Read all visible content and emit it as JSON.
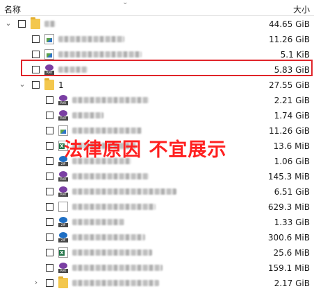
{
  "header": {
    "name_col": "名称",
    "size_col": "大小",
    "sort_glyph": "⌄"
  },
  "rows": [
    {
      "level": 0,
      "expand": "⌄",
      "icon": "folder",
      "name_blurred": true,
      "size": "44.65 GiB"
    },
    {
      "level": 1,
      "expand": "",
      "icon": "image-file",
      "name_blurred": true,
      "size": "11.26 GiB"
    },
    {
      "level": 1,
      "expand": "",
      "icon": "image-file",
      "name_blurred": true,
      "size": "5.1 KiB"
    },
    {
      "level": 1,
      "expand": "",
      "icon": "rar-archive",
      "name_blurred": true,
      "size": "5.83 GiB",
      "highlighted": true
    },
    {
      "level": 1,
      "expand": "⌄",
      "icon": "folder",
      "name": "1",
      "size": "27.55 GiB"
    },
    {
      "level": 2,
      "expand": "",
      "icon": "rar-archive",
      "name_blurred": true,
      "size": "2.21 GiB"
    },
    {
      "level": 2,
      "expand": "",
      "icon": "rar-archive",
      "name_blurred": true,
      "size": "1.74 GiB"
    },
    {
      "level": 2,
      "expand": "",
      "icon": "image-file",
      "name_blurred": true,
      "size": "11.26 GiB"
    },
    {
      "level": 2,
      "expand": "",
      "icon": "excel-file",
      "name_blurred": true,
      "size": "13.6 MiB"
    },
    {
      "level": 2,
      "expand": "",
      "icon": "zip-archive",
      "name_blurred": true,
      "size": "1.06 GiB"
    },
    {
      "level": 2,
      "expand": "",
      "icon": "rar-archive",
      "name_blurred": true,
      "size": "145.3 MiB"
    },
    {
      "level": 2,
      "expand": "",
      "icon": "rar-archive",
      "name_blurred": true,
      "size": "6.51 GiB"
    },
    {
      "level": 2,
      "expand": "",
      "icon": "blank-file",
      "name_blurred": true,
      "size": "629.3 MiB"
    },
    {
      "level": 2,
      "expand": "",
      "icon": "zip-archive",
      "name_blurred": true,
      "size": "1.33 GiB"
    },
    {
      "level": 2,
      "expand": "",
      "icon": "zip-archive",
      "name_blurred": true,
      "size": "300.6 MiB"
    },
    {
      "level": 2,
      "expand": "",
      "icon": "excel-file",
      "name_blurred": true,
      "size": "25.6 MiB"
    },
    {
      "level": 2,
      "expand": "",
      "icon": "rar-archive",
      "name_blurred": true,
      "size": "159.1 MiB"
    },
    {
      "level": 2,
      "expand": "›",
      "icon": "folder",
      "name_blurred": true,
      "size": "2.17 GiB"
    }
  ],
  "overlay_text": "法律原因 不宜展示",
  "colors": {
    "highlight_border": "#e0242a",
    "overlay_text": "#ff2020",
    "folder": "#f3c74d"
  }
}
